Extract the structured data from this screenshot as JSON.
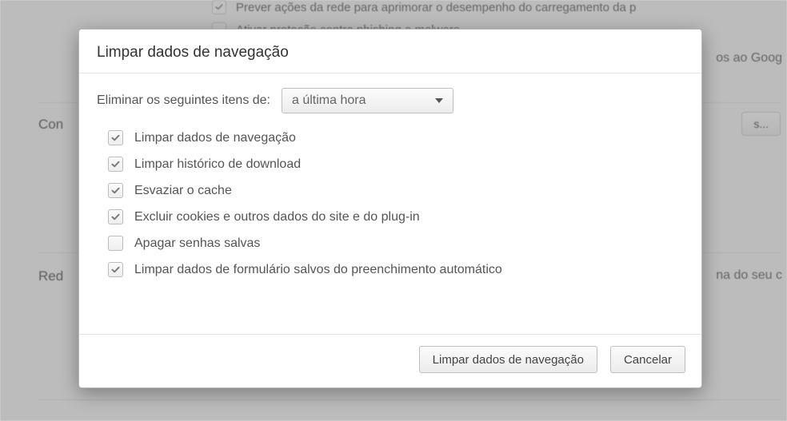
{
  "background": {
    "option1": "Prever ações da rede para aprimorar o desempenho do carregamento da p",
    "option2": "Ativar proteção contra phishing e malware",
    "section_con": "Con",
    "section_red": "Red",
    "text_right_top": "os ao Goog",
    "text_right_mid": "na do seu c",
    "btn_s": "s..."
  },
  "dialog": {
    "title": "Limpar dados de navegação",
    "range_label": "Eliminar os seguintes itens de:",
    "range_selected": "a última hora",
    "items": [
      {
        "label": "Limpar dados de navegação",
        "checked": true
      },
      {
        "label": "Limpar histórico de download",
        "checked": true
      },
      {
        "label": "Esvaziar o cache",
        "checked": true
      },
      {
        "label": "Excluir cookies e outros dados do site e do plug-in",
        "checked": true
      },
      {
        "label": "Apagar senhas salvas",
        "checked": false
      },
      {
        "label": "Limpar dados de formulário salvos do preenchimento automático",
        "checked": true
      }
    ],
    "primary_label": "Limpar dados de navegação",
    "cancel_label": "Cancelar"
  }
}
